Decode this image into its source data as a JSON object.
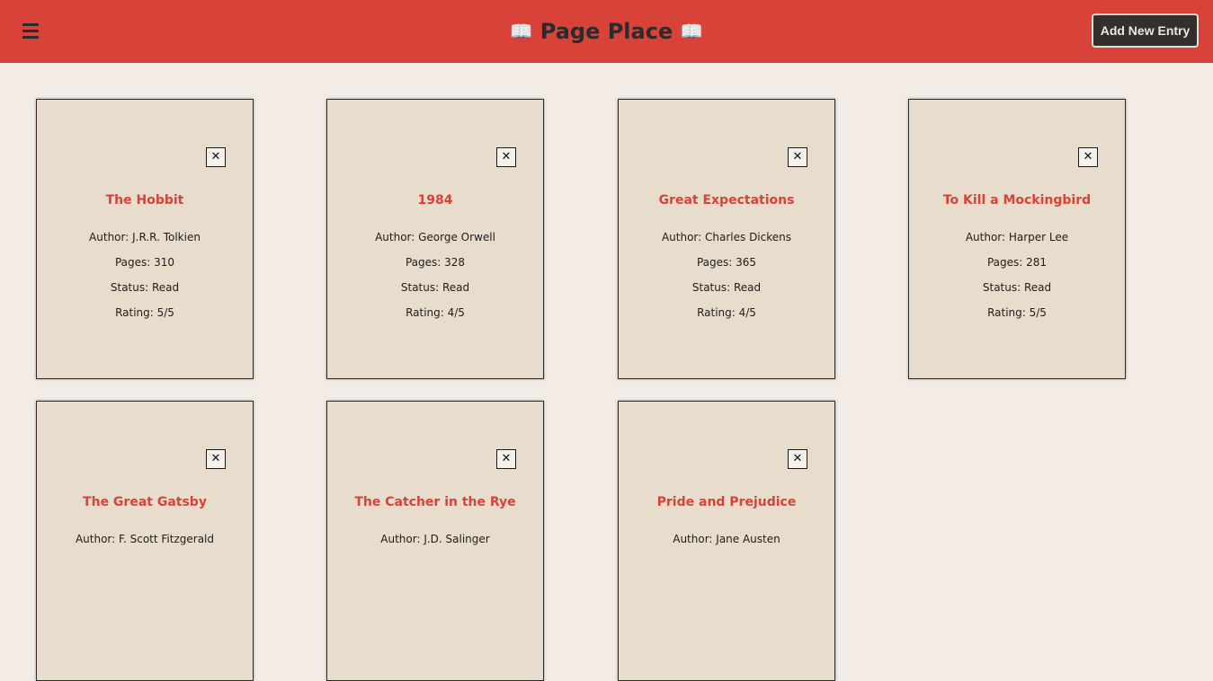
{
  "header": {
    "title": "Page Place",
    "add_button_label": "Add New Entry",
    "menu_icon": "hamburger-icon",
    "title_icons": "open-book-icon"
  },
  "cards": [
    {
      "title": "The Hobbit",
      "author": "Author: J.R.R. Tolkien",
      "pages": "Pages: 310",
      "status": "Status: Read",
      "rating": "Rating: 5/5"
    },
    {
      "title": "1984",
      "author": "Author: George Orwell",
      "pages": "Pages: 328",
      "status": "Status: Read",
      "rating": "Rating: 4/5"
    },
    {
      "title": "Great Expectations",
      "author": "Author: Charles Dickens",
      "pages": "Pages: 365",
      "status": "Status: Read",
      "rating": "Rating: 4/5"
    },
    {
      "title": "To Kill a Mockingbird",
      "author": "Author: Harper Lee",
      "pages": "Pages: 281",
      "status": "Status: Read",
      "rating": "Rating: 5/5"
    },
    {
      "title": "The Great Gatsby",
      "author": "Author: F. Scott Fitzgerald"
    },
    {
      "title": "The Catcher in the Rye",
      "author": "Author: J.D. Salinger"
    },
    {
      "title": "Pride and Prejudice",
      "author": "Author: Jane Austen"
    }
  ],
  "close_symbol": "✕",
  "colors": {
    "header_bg": "#d84238",
    "page_bg": "#f3ece6",
    "card_bg": "#e8dccc",
    "title_text": "#d84238",
    "button_bg": "#342e2c"
  }
}
